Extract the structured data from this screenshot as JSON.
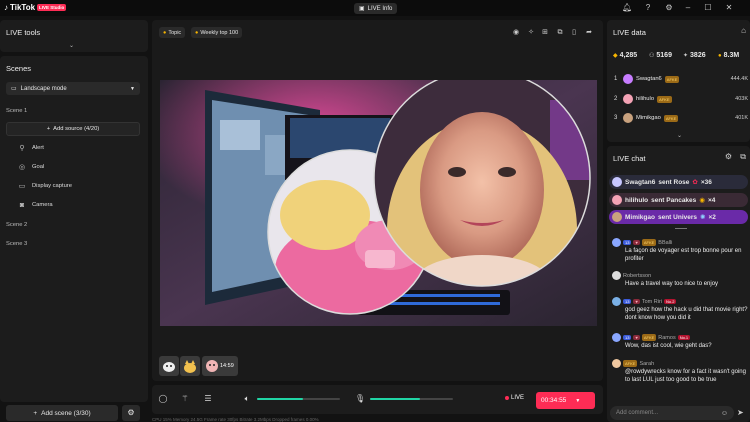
{
  "app": {
    "name": "TikTok",
    "badge": "LIVE Studio",
    "center_button": "LIVE Info"
  },
  "left": {
    "live_tools_title": "LIVE tools",
    "scenes_title": "Scenes",
    "mode_label": "Landscape mode",
    "scene1": "Scene 1",
    "add_source": "Add source (4/20)",
    "sources": [
      "Alert",
      "Goal",
      "Display capture",
      "Camera"
    ],
    "scene2": "Scene 2",
    "scene3": "Scene 3",
    "add_scene": "Add scene (3/30)"
  },
  "stage": {
    "chips": [
      "Topic",
      "Weekly top 100"
    ],
    "thumb_time": "14:59"
  },
  "controls": {
    "mic_level": 0.55,
    "audio_level": 0.6,
    "live_label": "LIVE",
    "timer": "00:34:55"
  },
  "stats_row": "CPU 15%  Memory 24.5G  Frame rate 30fps  Bitrate 3.2Mbps  Dropped frames 0.00%",
  "live_data": {
    "title": "LIVE data",
    "stats": [
      "4,285",
      "5169",
      "3826",
      "8.3M"
    ],
    "ranking": [
      {
        "rank": "1",
        "name": "Swagtan6",
        "tag": "AFKE",
        "coins": "444.4K",
        "color": "#c77dff"
      },
      {
        "rank": "2",
        "name": "hilihulo",
        "tag": "AFKE",
        "coins": "403K",
        "color": "#f4a3b5"
      },
      {
        "rank": "3",
        "name": "Mimikgao",
        "tag": "AFKE",
        "coins": "401K",
        "color": "#c9a27e"
      }
    ]
  },
  "live_chat": {
    "title": "LIVE chat",
    "gifts": [
      {
        "user": "Swagtan6",
        "text": "sent Rose",
        "count": "×36"
      },
      {
        "user": "hilihulo",
        "text": "sent Pancakes",
        "count": "×4"
      },
      {
        "user": "Mimikgao",
        "text": "sent Univers",
        "count": "×2"
      }
    ],
    "messages": [
      {
        "level": "13",
        "tag": "AFKE",
        "name": "BBalli",
        "text": "La façon de voyager est trop bonne pour en profiter"
      },
      {
        "level": "",
        "tag": "",
        "name": "Robertsson",
        "text": "Have a travel way too nice to enjoy"
      },
      {
        "level": "13",
        "tag": "",
        "name": "Tom Riri",
        "badge": "No.2",
        "text": "god geez how the hack u did that movie right? dont know how you did it"
      },
      {
        "level": "13",
        "tag": "AFKE",
        "name": "Ramos",
        "badge": "No.1",
        "text": "Wow, das ist cool, wie geht das?"
      },
      {
        "level": "",
        "tag": "AFKE",
        "name": "Sarah",
        "text": "@rowdywrecks know for a fact it wasn't going to last LUL just too good to be true"
      }
    ],
    "comment_placeholder": "Add comment..."
  }
}
